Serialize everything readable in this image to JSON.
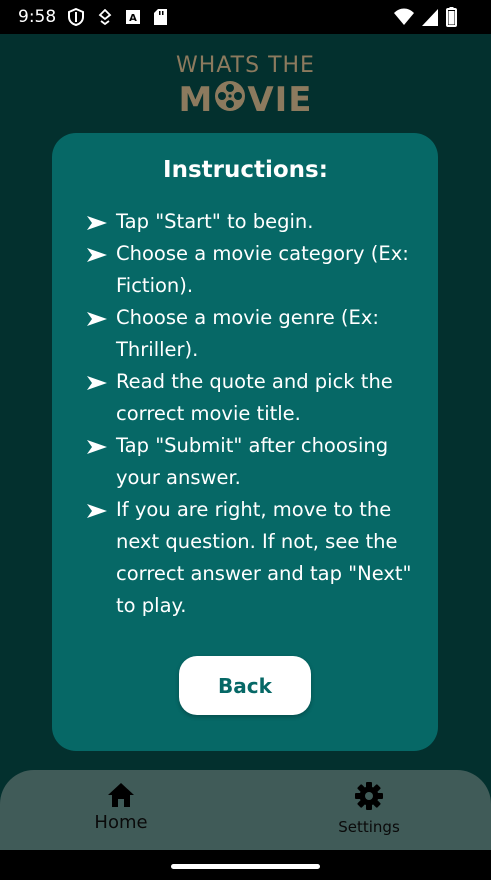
{
  "status_bar": {
    "time": "9:58",
    "icons": [
      "shield-icon",
      "location-icon",
      "a-badge-icon",
      "sd-card-icon",
      "wifi-icon",
      "signal-icon",
      "battery-icon"
    ]
  },
  "logo": {
    "line1": "WHATS THE",
    "line2_left": "M",
    "line2_right": "VIE"
  },
  "card": {
    "title": "Instructions:",
    "items": [
      "Tap \"Start\" to begin.",
      "Choose a movie category (Ex: Fiction).",
      "Choose a movie genre (Ex: Thriller).",
      "Read the quote and pick the correct movie title.",
      "Tap \"Submit\" after choosing your answer.",
      "If you are right, move to the next question. If not, see the correct answer and tap \"Next\" to play."
    ],
    "back_label": "Back"
  },
  "nav": {
    "home_label": "Home",
    "settings_label": "Settings"
  },
  "colors": {
    "background": "#03302e",
    "card": "#066866",
    "logo": "#8c7a5e",
    "nav": "#405b58",
    "button_text": "#066866"
  }
}
